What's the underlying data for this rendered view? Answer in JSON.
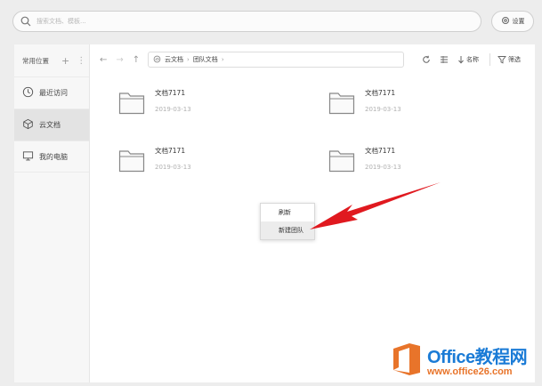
{
  "search": {
    "placeholder": "搜索文档、模板..."
  },
  "settings": {
    "label": "设置"
  },
  "sidebar": {
    "header": "常用位置",
    "items": [
      {
        "label": "最近访问",
        "icon": "clock-icon"
      },
      {
        "label": "云文档",
        "icon": "cube-icon"
      },
      {
        "label": "我的电脑",
        "icon": "monitor-icon"
      }
    ]
  },
  "toolbar": {
    "breadcrumb": [
      "云文档",
      "团队文档"
    ],
    "sort_label": "名称",
    "filter_label": "筛选"
  },
  "files": [
    {
      "name": "文档7171",
      "date": "2019-03-13"
    },
    {
      "name": "文档7171",
      "date": "2019-03-13"
    },
    {
      "name": "文档7171",
      "date": "2019-03-13"
    },
    {
      "name": "文档7171",
      "date": "2019-03-13"
    }
  ],
  "context_menu": {
    "items": [
      "刷新",
      "新建团队"
    ]
  },
  "watermark": {
    "line1": "Office教程网",
    "line2": "www.office26.com"
  },
  "colors": {
    "arrow": "#e0191f",
    "watermark_blue": "#1a7bd6",
    "watermark_orange": "#e8742a"
  }
}
